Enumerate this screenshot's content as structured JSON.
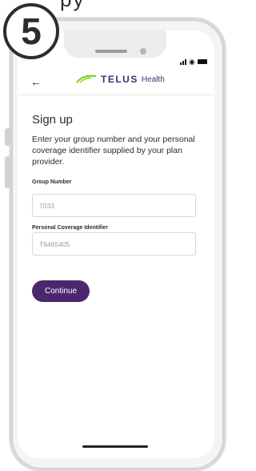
{
  "top_partial_text": "py",
  "step_number": "5",
  "app": {
    "brand": "TELUS",
    "brand_sub": "Health"
  },
  "page": {
    "title": "Sign up",
    "description": "Enter your group number and your personal coverage identifier supplied by your plan provider."
  },
  "fields": {
    "group_number": {
      "label": "Group Number",
      "placeholder": "7033"
    },
    "personal_coverage": {
      "label": "Personal Coverage Identifier",
      "placeholder": "T6465405"
    }
  },
  "button": {
    "continue_label": "Continue"
  },
  "colors": {
    "primary": "#4b286d",
    "text": "#2a2c2e"
  },
  "icons": [
    "back-arrow-icon",
    "telus-logo-icon",
    "signal-icon",
    "wifi-icon",
    "battery-icon"
  ]
}
